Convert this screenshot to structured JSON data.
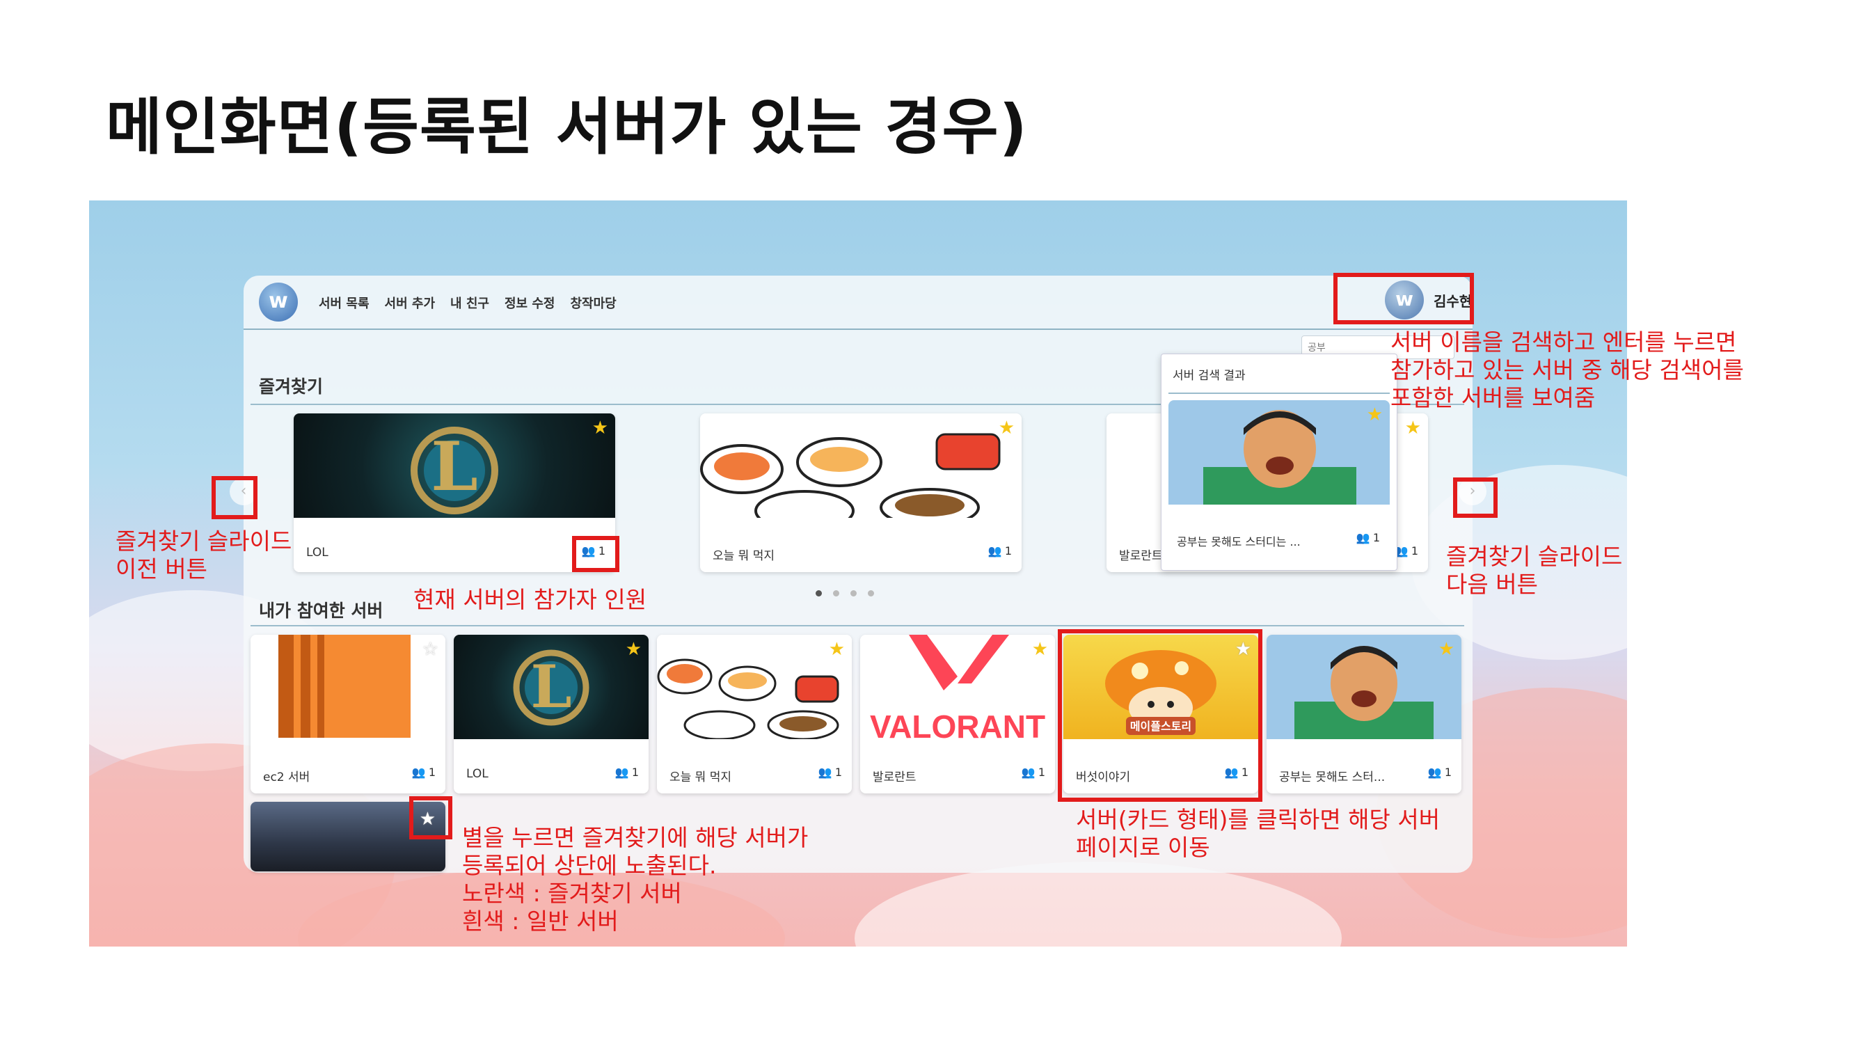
{
  "slide_title": "메인화면(등록된 서버가 있는 경우)",
  "app": {
    "logo_letter": "w",
    "nav_menu": [
      "서버 목록",
      "서버 추가",
      "내 친구",
      "정보 수정",
      "창작마당"
    ],
    "user": {
      "avatar_letter": "w",
      "name": "김수현"
    },
    "search": {
      "value": "공부",
      "result_title": "서버 검색 결과"
    }
  },
  "favorites": {
    "title": "즐겨찾기",
    "cards": [
      {
        "name": "LOL",
        "count": "1",
        "starred": true
      },
      {
        "name": "오늘 뭐 먹지",
        "count": "1",
        "starred": true
      },
      {
        "name": "발로란트",
        "count": "1",
        "starred": true
      }
    ],
    "carousel_dots": 4,
    "active_dot": 0
  },
  "search_result_card": {
    "name": "공부는 못해도 스터디는 ...",
    "count": "1",
    "starred": true
  },
  "joined": {
    "title": "내가 참여한 서버",
    "cards": [
      {
        "name": "ec2 서버",
        "count": "1",
        "starred": false
      },
      {
        "name": "LOL",
        "count": "1",
        "starred": true
      },
      {
        "name": "오늘 뭐 먹지",
        "count": "1",
        "starred": true
      },
      {
        "name": "발로란트",
        "count": "1",
        "starred": true
      },
      {
        "name": "버섯이야기",
        "count": "1",
        "starred": true
      },
      {
        "name": "공부는 못해도 스터...",
        "count": "1",
        "starred": true
      }
    ],
    "extra_card_starred": false
  },
  "thumb_text": {
    "valorant": "VALORANT",
    "maple": "메이플스토리"
  },
  "annotations": {
    "prev": "즐겨찾기 슬라이드\n 이전 버튼",
    "next": "즐겨찾기 슬라이드\n 다음 버튼",
    "count": "현재 서버의 참가자 인원",
    "search": "서버 이름을 검색하고 엔터를 누르면\n참가하고 있는 서버 중 해당 검색어를\n포함한 서버를 보여줌",
    "card": "서버(카드 형태)를 클릭하면 해당 서버\n페이지로 이동",
    "star": "별을 누르면 즐겨찾기에 해당 서버가\n등록되어 상단에 노출된다.\n노란색 : 즐겨찾기 서버\n흰색 : 일반 서버"
  },
  "colors": {
    "annotation_red": "#e21b1b",
    "favorite_star": "#f5c518"
  }
}
